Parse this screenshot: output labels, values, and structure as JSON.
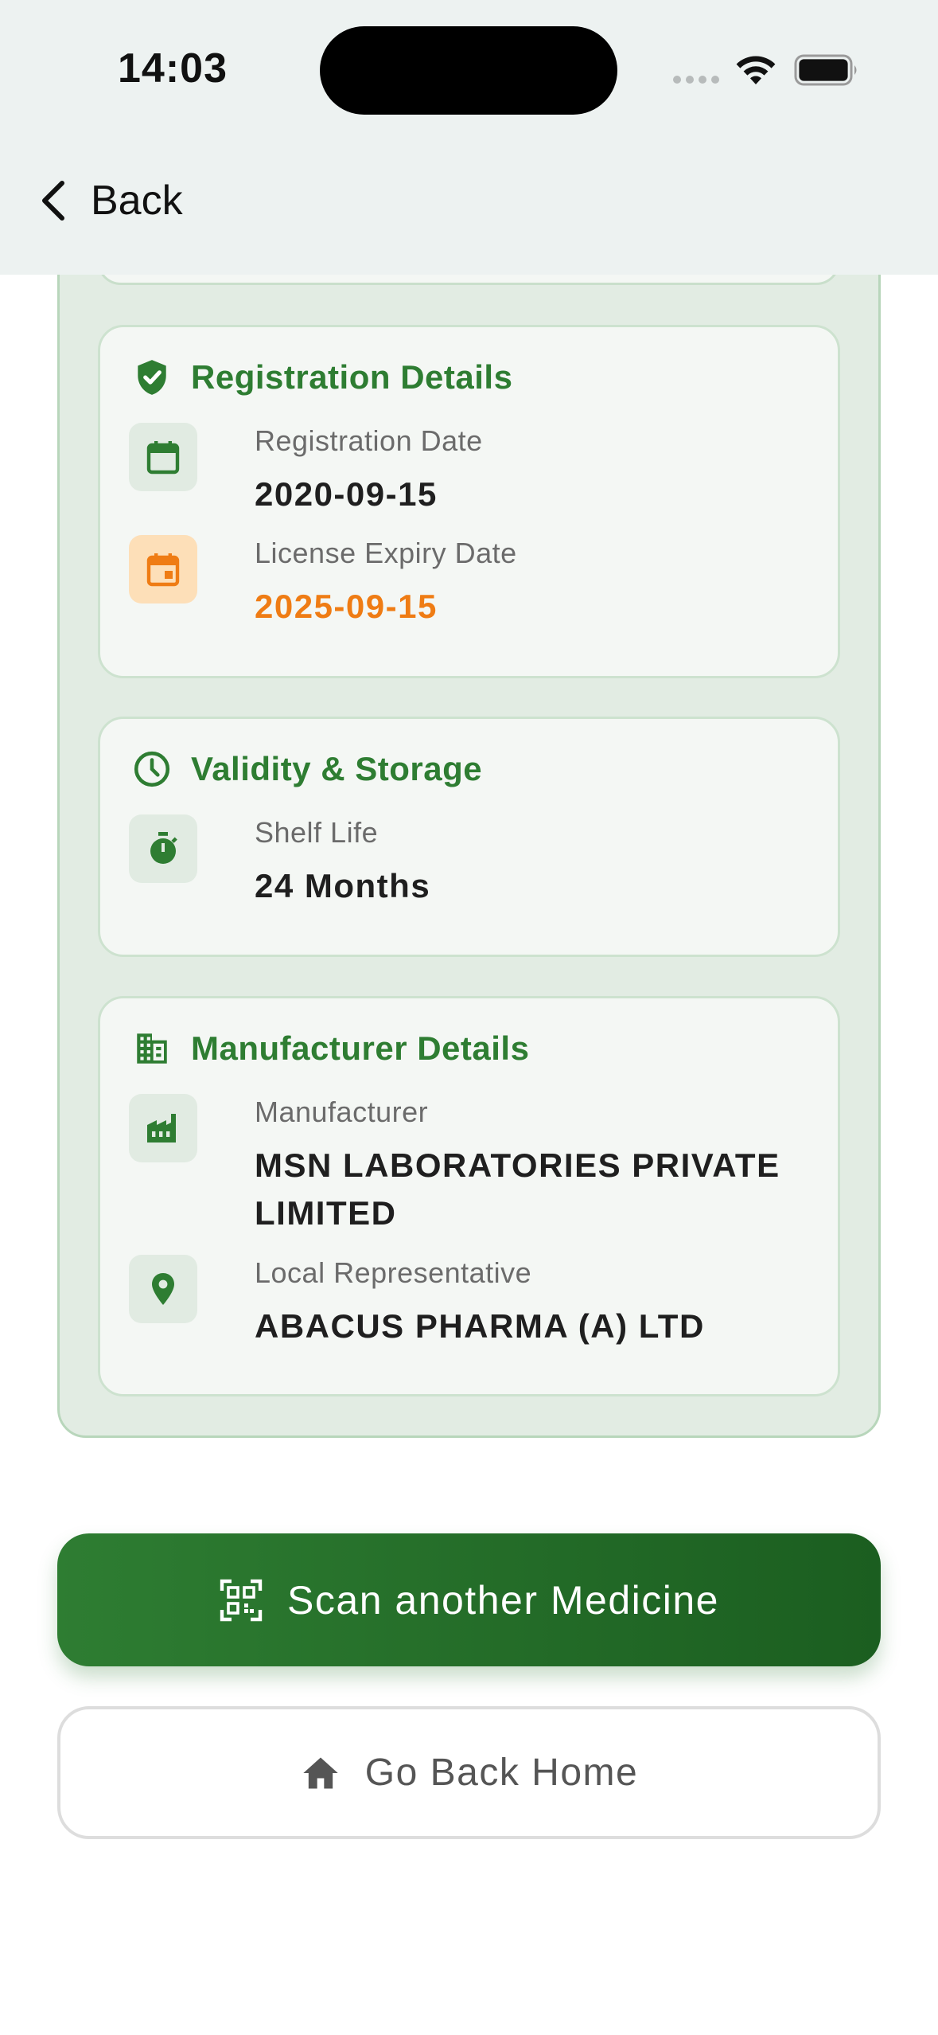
{
  "status_bar": {
    "time": "14:03"
  },
  "nav": {
    "back_label": "Back"
  },
  "cards": {
    "registration": {
      "title": "Registration Details",
      "registration_date_label": "Registration Date",
      "registration_date_value": "2020-09-15",
      "license_expiry_label": "License Expiry Date",
      "license_expiry_value": "2025-09-15"
    },
    "validity": {
      "title": "Validity & Storage",
      "shelf_life_label": "Shelf Life",
      "shelf_life_value": "24 Months"
    },
    "manufacturer": {
      "title": "Manufacturer Details",
      "manufacturer_label": "Manufacturer",
      "manufacturer_value": "MSN LABORATORIES PRIVATE LIMITED",
      "local_rep_label": "Local Representative",
      "local_rep_value": "ABACUS PHARMA (A) LTD"
    }
  },
  "actions": {
    "scan_label": "Scan another Medicine",
    "home_label": "Go Back Home"
  },
  "colors": {
    "accent_green": "#2e7d32",
    "warning_orange": "#ef7c14"
  },
  "icons": {
    "registration": "shield-check-icon",
    "registration_date": "calendar-icon",
    "expiry": "calendar-event-icon",
    "validity": "clock-icon",
    "shelf_life": "timer-icon",
    "manufacturer_section": "building-icon",
    "manufacturer": "factory-icon",
    "local_rep": "location-pin-icon",
    "scan": "qr-scan-icon",
    "home": "home-icon"
  }
}
